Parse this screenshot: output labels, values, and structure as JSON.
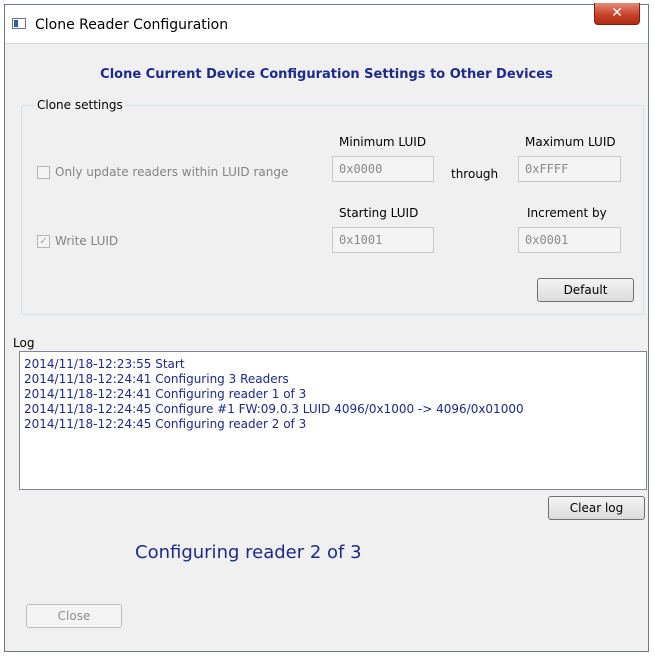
{
  "window": {
    "title": "Clone Reader Configuration",
    "close_glyph": "✕"
  },
  "heading": "Clone Current Device Configuration Settings to Other Devices",
  "clone_settings": {
    "title": "Clone settings",
    "only_update_label": "Only update readers within LUID range",
    "only_update_checked": false,
    "min_luid_label": "Minimum LUID",
    "min_luid_value": "0x0000",
    "through_label": "through",
    "max_luid_label": "Maximum LUID",
    "max_luid_value": "0xFFFF",
    "write_luid_label": "Write LUID",
    "write_luid_checked": true,
    "starting_luid_label": "Starting LUID",
    "starting_luid_value": "0x1001",
    "increment_label": "Increment by",
    "increment_value": "0x0001",
    "default_button": "Default"
  },
  "log": {
    "label": "Log",
    "lines": [
      "2014/11/18-12:23:55 Start",
      "2014/11/18-12:24:41 Configuring 3 Readers",
      "2014/11/18-12:24:41 Configuring reader 1 of 3",
      "2014/11/18-12:24:45 Configure #1 FW:09.0.3 LUID 4096/0x1000 -> 4096/0x01000",
      "2014/11/18-12:24:45 Configuring reader 2 of 3"
    ],
    "clear_button": "Clear log"
  },
  "status_text": "Configuring reader 2 of 3",
  "close_button": "Close",
  "colors": {
    "accent_text": "#1c2a8c",
    "close_button_red": "#c8432a"
  }
}
